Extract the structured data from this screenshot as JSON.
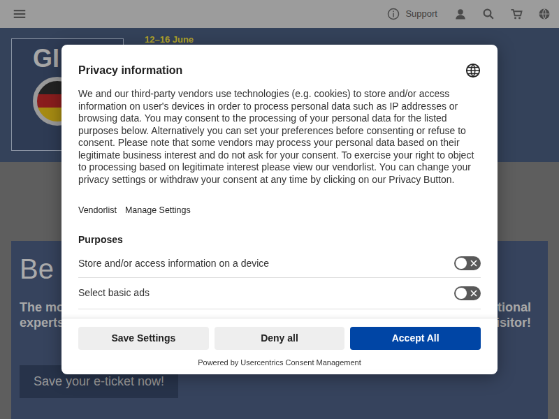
{
  "header": {
    "support": "Support"
  },
  "banner": {
    "logo": "GI",
    "dates": "12–16 June"
  },
  "hero": {
    "heading": "Be",
    "lines": [
      {
        "left": "The mo",
        "right": "tional"
      },
      {
        "left": "experts",
        "right": "isitor!"
      }
    ],
    "button": "Save your e-ticket now!"
  },
  "dialog": {
    "title": "Privacy information",
    "text": "We and our third-party vendors use technologies (e.g. cookies) to store and/or access information on user's devices in order to process personal data such as IP addresses or browsing data. You may consent to the processing of your personal data for the listed purposes below. Alternatively you can set your preferences before consenting or refuse to consent. Please note that some vendors may process your personal data based on their legitimate business interest and do not ask for your consent. To exercise your right to object to processing based on legitimate interest please view our vendorlist. You can change your privacy settings or withdraw your consent at any time by clicking on our Privacy Button.",
    "links": [
      "Vendorlist",
      "Manage Settings"
    ],
    "purposes_title": "Purposes",
    "purposes": [
      {
        "label": "Store and/or access information on a device",
        "checked": false
      },
      {
        "label": "Select basic ads",
        "checked": false
      },
      {
        "checked": false
      }
    ],
    "buttons": [
      {
        "label": "Save Settings",
        "kind": "secondary"
      },
      {
        "label": "Deny all",
        "kind": "secondary"
      },
      {
        "label": "Accept All",
        "kind": "primary"
      }
    ],
    "footer": "Powered by Usercentrics Consent Management"
  }
}
